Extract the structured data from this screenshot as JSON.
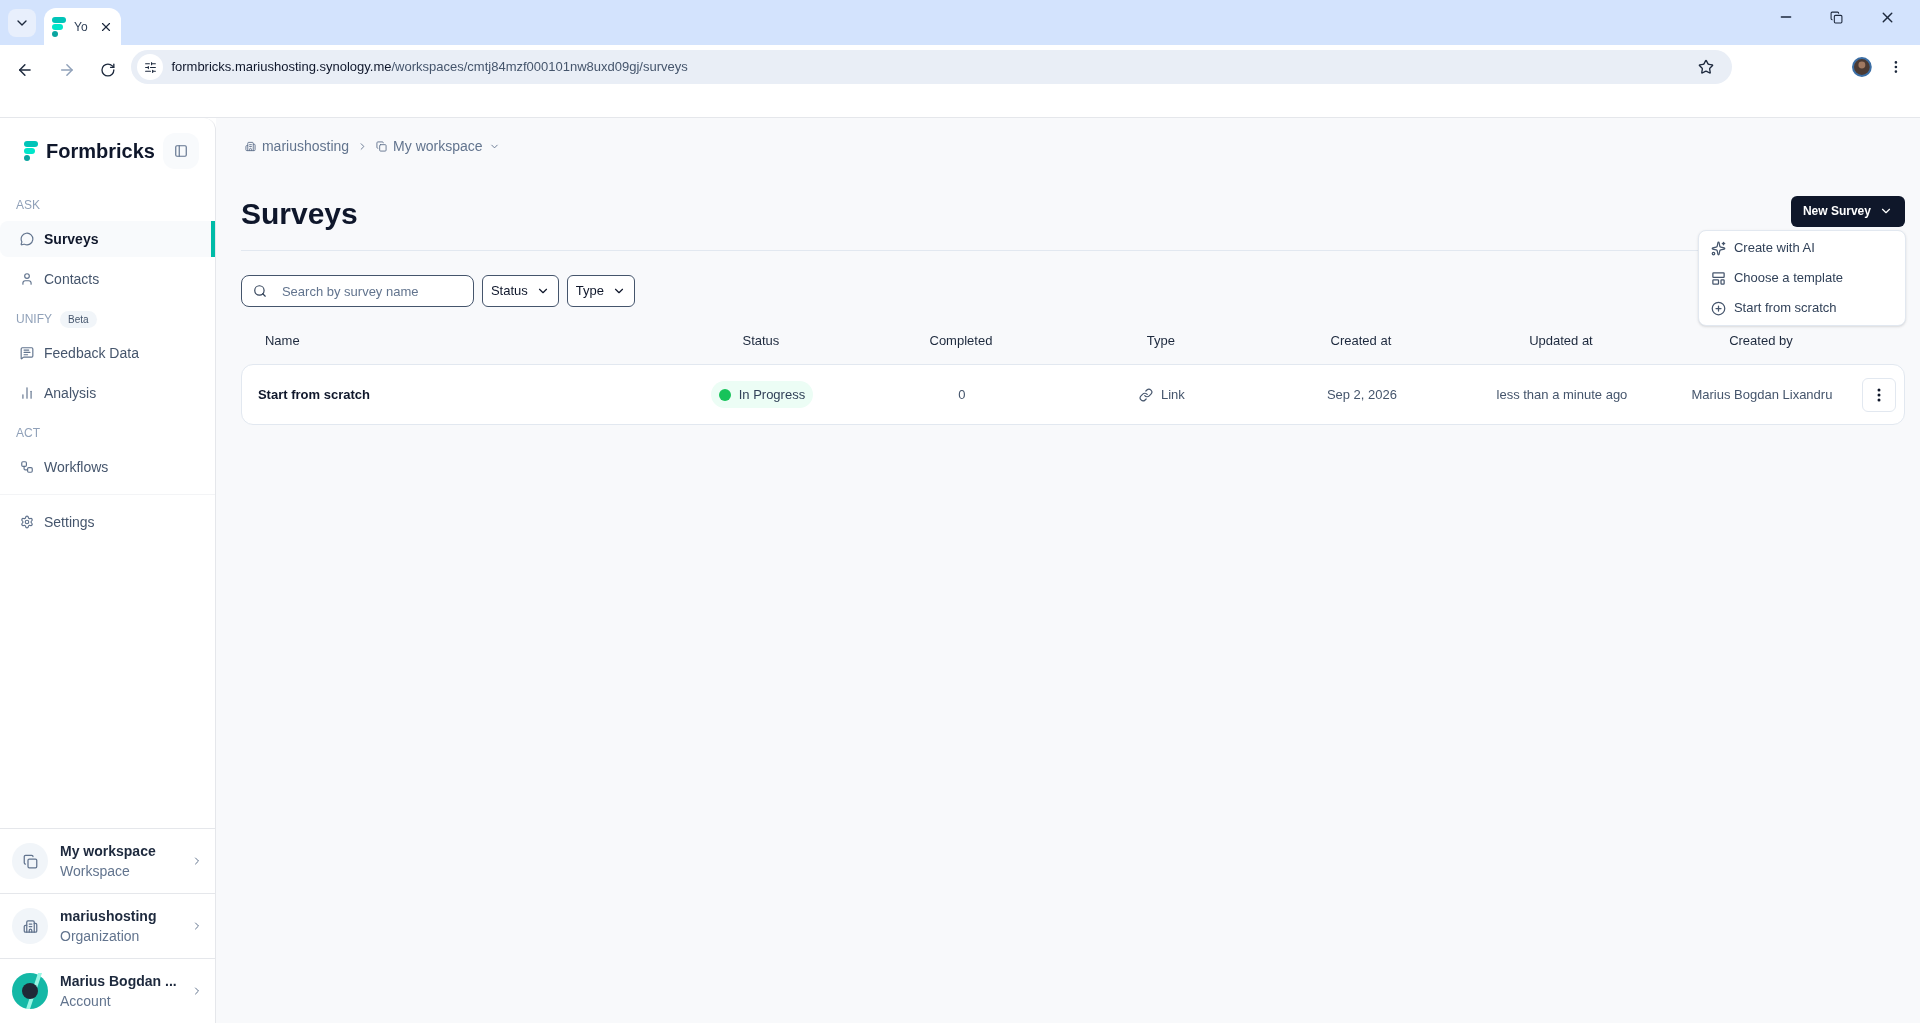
{
  "browser": {
    "tab_title": "Yo",
    "url_domain": "formbricks.mariushosting.synology.me",
    "url_path": "/workspaces/cmtj84mzf000101nw8uxd09gj/surveys"
  },
  "sidebar": {
    "brand": "Formbricks",
    "sections": [
      {
        "label": "ASK",
        "items": [
          {
            "label": "Surveys",
            "selected": true
          },
          {
            "label": "Contacts",
            "selected": false
          }
        ]
      },
      {
        "label": "UNIFY",
        "badge": "Beta",
        "items": [
          {
            "label": "Feedback Data",
            "selected": false
          },
          {
            "label": "Analysis",
            "selected": false
          }
        ]
      },
      {
        "label": "ACT",
        "items": [
          {
            "label": "Workflows",
            "selected": false
          }
        ]
      }
    ],
    "settings": {
      "label": "Settings",
      "selected": false
    },
    "cards": [
      {
        "kind": "workspace",
        "title": "My workspace",
        "subtitle": "Workspace"
      },
      {
        "kind": "organization",
        "title": "mariushosting",
        "subtitle": "Organization"
      },
      {
        "kind": "account",
        "title": "Marius Bogdan ...",
        "subtitle": "Account"
      }
    ]
  },
  "breadcrumb": [
    {
      "label": "mariushosting",
      "dropdown": false
    },
    {
      "label": "My workspace",
      "dropdown": true
    }
  ],
  "title": "Surveys",
  "new_survey_button": "New Survey",
  "menu": [
    "Create with AI",
    "Choose a template",
    "Start from scratch"
  ],
  "search": {
    "placeholder": "Search by survey name"
  },
  "filters": [
    "Status",
    "Type"
  ],
  "table": {
    "columns": [
      "Name",
      "Status",
      "Completed",
      "Type",
      "Created at",
      "Updated at",
      "Created by"
    ],
    "rows": [
      {
        "name": "Start from scratch",
        "status": {
          "label": "In Progress",
          "color": "#16c35a"
        },
        "completed": "0",
        "type": "Link",
        "created_at": "Sep 2, 2026",
        "updated_at": "less than a minute ago",
        "created_by": "Marius Bogdan Lixandru"
      }
    ]
  }
}
